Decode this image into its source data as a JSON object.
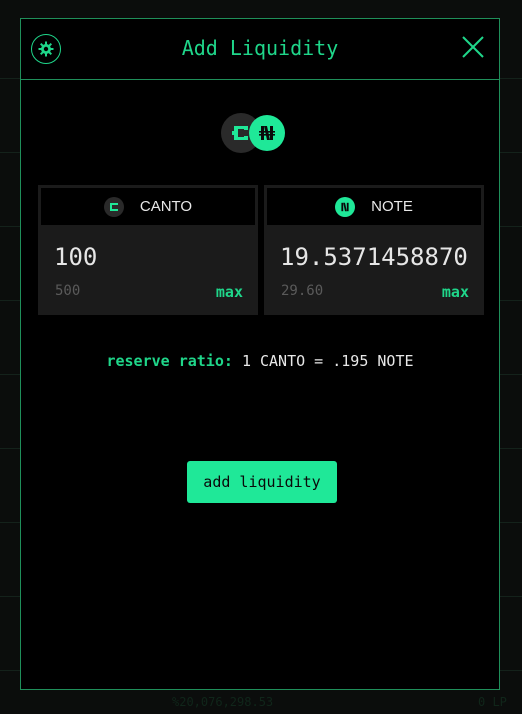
{
  "modal": {
    "title": "Add Liquidity",
    "colors": {
      "accent": "#1fd68a",
      "button": "#1fe898",
      "card": "#1b1b1b"
    }
  },
  "tokens": [
    {
      "symbol": "CANTO",
      "amount": "100",
      "balance": "500",
      "max_label": "max",
      "icon": "canto-coin-icon"
    },
    {
      "symbol": "NOTE",
      "amount": "19.5371458870",
      "balance": "29.60",
      "max_label": "max",
      "icon": "note-coin-icon"
    }
  ],
  "reserve": {
    "label": "reserve ratio:",
    "value": "1 CANTO = .195 NOTE"
  },
  "action": {
    "label": "add liquidity"
  },
  "background": {
    "left_text": "%20,076,298.53",
    "right_text": "0 LP"
  }
}
